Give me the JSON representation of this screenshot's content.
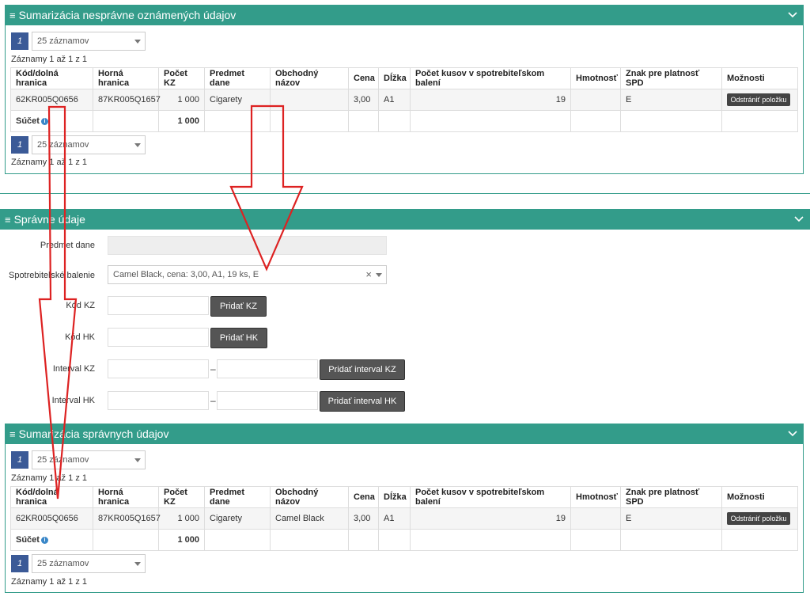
{
  "accent_color": "#339c8a",
  "page_btn_color": "#3b5a97",
  "arrow_color": "#dd2222",
  "top_panel": {
    "title": "Sumarizácia nesprávne oznámených údajov",
    "pager_top": {
      "page": "1",
      "per_page": "25 záznamov"
    },
    "info_top": "Záznamy 1 až 1 z 1",
    "pager_bottom": {
      "page": "1",
      "per_page": "25 záznamov"
    },
    "info_bottom": "Záznamy 1 až 1 z 1",
    "columns": [
      "Kód/dolná hranica",
      "Horná hranica",
      "Počet KZ",
      "Predmet dane",
      "Obchodný názov",
      "Cena",
      "Dĺžka",
      "Počet kusov v spotrebiteľskom balení",
      "Hmotnosť",
      "Znak pre platnosť SPD",
      "Možnosti"
    ],
    "row": {
      "kod": "62KR005Q0656",
      "horna": "87KR005Q1657",
      "pocet": "1 000",
      "predmet": "Cigarety",
      "nazov": "",
      "cena": "3,00",
      "dlzka": "A1",
      "kusov": "19",
      "hmotnost": "",
      "znak": "E",
      "action": "Odstrániť položku"
    },
    "sum": {
      "label": "Súčet",
      "pocet": "1 000"
    }
  },
  "correct_panel": {
    "title": "Správne údaje",
    "labels": {
      "predmet": "Predmet dane",
      "balenie": "Spotrebiteľské balenie",
      "kod_kz": "Kód KZ",
      "kod_hk": "Kód HK",
      "interval_kz": "Interval KZ",
      "interval_hk": "Interval HK"
    },
    "balenie_value": "Camel Black, cena: 3,00, A1, 19 ks, E",
    "dash": "–",
    "buttons": {
      "add_kz": "Pridať KZ",
      "add_hk": "Pridať HK",
      "add_interval_kz": "Pridať interval KZ",
      "add_interval_hk": "Pridať interval HK"
    }
  },
  "bottom_panel": {
    "title": "Sumarizácia správnych údajov",
    "pager_top": {
      "page": "1",
      "per_page": "25 záznamov"
    },
    "info_top": "Záznamy 1 až 1 z 1",
    "pager_bottom": {
      "page": "1",
      "per_page": "25 záznamov"
    },
    "info_bottom": "Záznamy 1 až 1 z 1",
    "columns": [
      "Kód/dolná hranica",
      "Horná hranica",
      "Počet KZ",
      "Predmet dane",
      "Obchodný názov",
      "Cena",
      "Dĺžka",
      "Počet kusov v spotrebiteľskom balení",
      "Hmotnosť",
      "Znak pre platnosť SPD",
      "Možnosti"
    ],
    "row": {
      "kod": "62KR005Q0656",
      "horna": "87KR005Q1657",
      "pocet": "1 000",
      "predmet": "Cigarety",
      "nazov": "Camel Black",
      "cena": "3,00",
      "dlzka": "A1",
      "kusov": "19",
      "hmotnost": "",
      "znak": "E",
      "action": "Odstrániť položku"
    },
    "sum": {
      "label": "Súčet",
      "pocet": "1 000"
    }
  }
}
